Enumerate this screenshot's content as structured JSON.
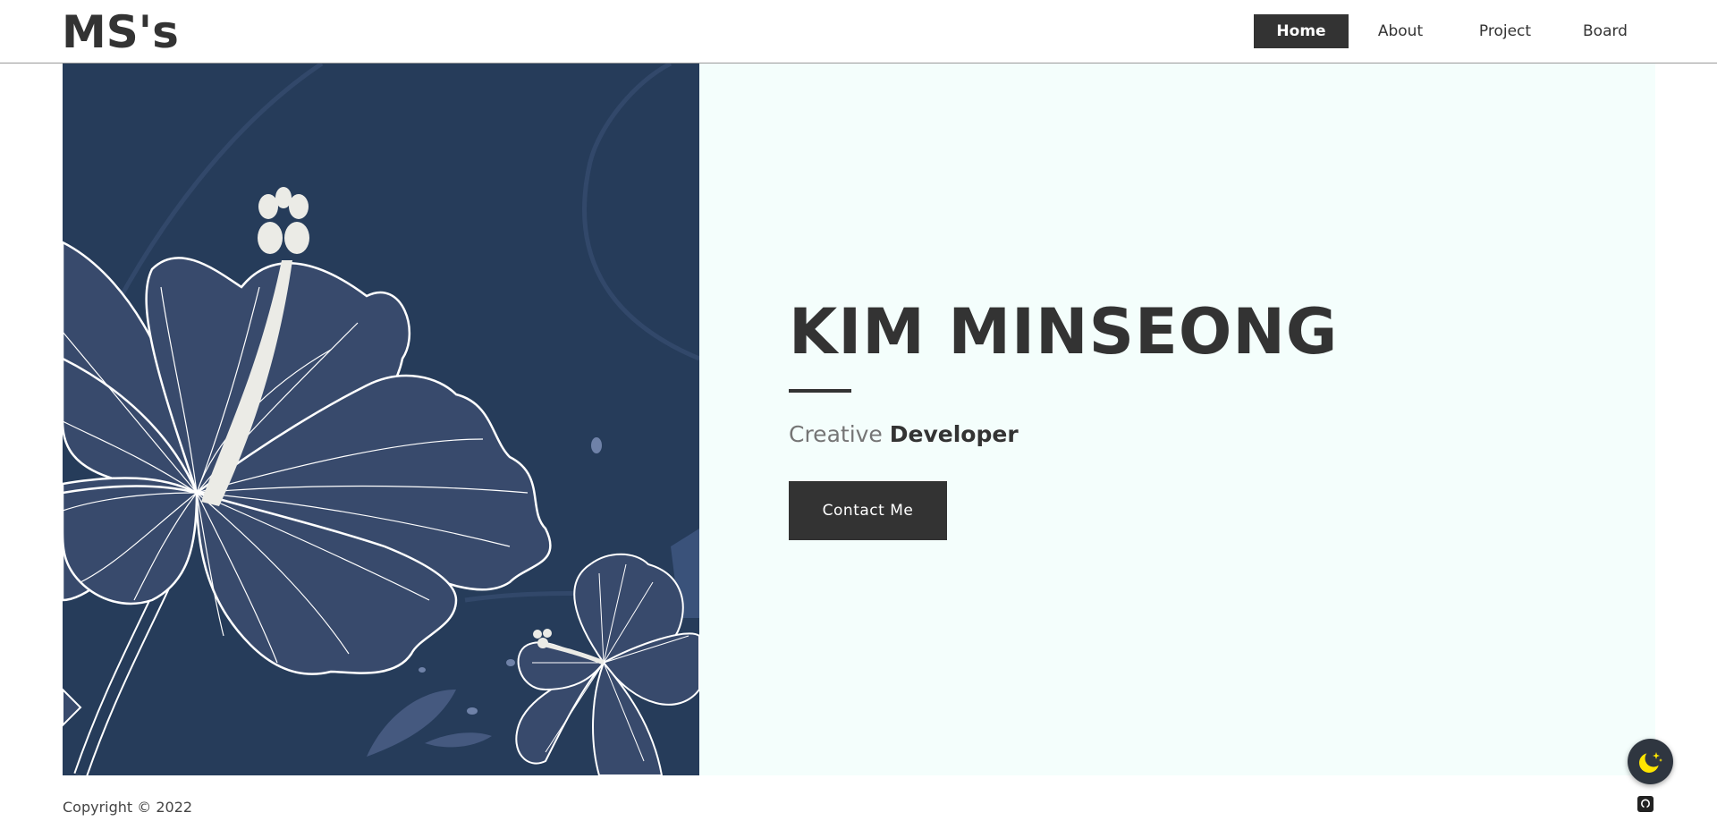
{
  "header": {
    "logo": "MS's",
    "nav": [
      {
        "label": "Home",
        "active": true
      },
      {
        "label": "About",
        "active": false
      },
      {
        "label": "Project",
        "active": false
      },
      {
        "label": "Board",
        "active": false
      }
    ]
  },
  "hero": {
    "name": "KIM MINSEONG",
    "subtitle_light": "Creative",
    "subtitle_strong": "Developer",
    "contact_label": "Contact Me",
    "image_icon": "hibiscus-illustration"
  },
  "footer": {
    "copyright": "Copyright © 2022",
    "github_icon": "github-icon"
  },
  "theme_toggle": {
    "icon": "moon-stars-icon"
  },
  "colors": {
    "primary": "#333333",
    "hero_left_bg": "#263c5a",
    "hero_right_bg": "#f4fefc",
    "petal": "#384a6c",
    "stamen": "#ebebe6",
    "moon": "#ffe600"
  }
}
